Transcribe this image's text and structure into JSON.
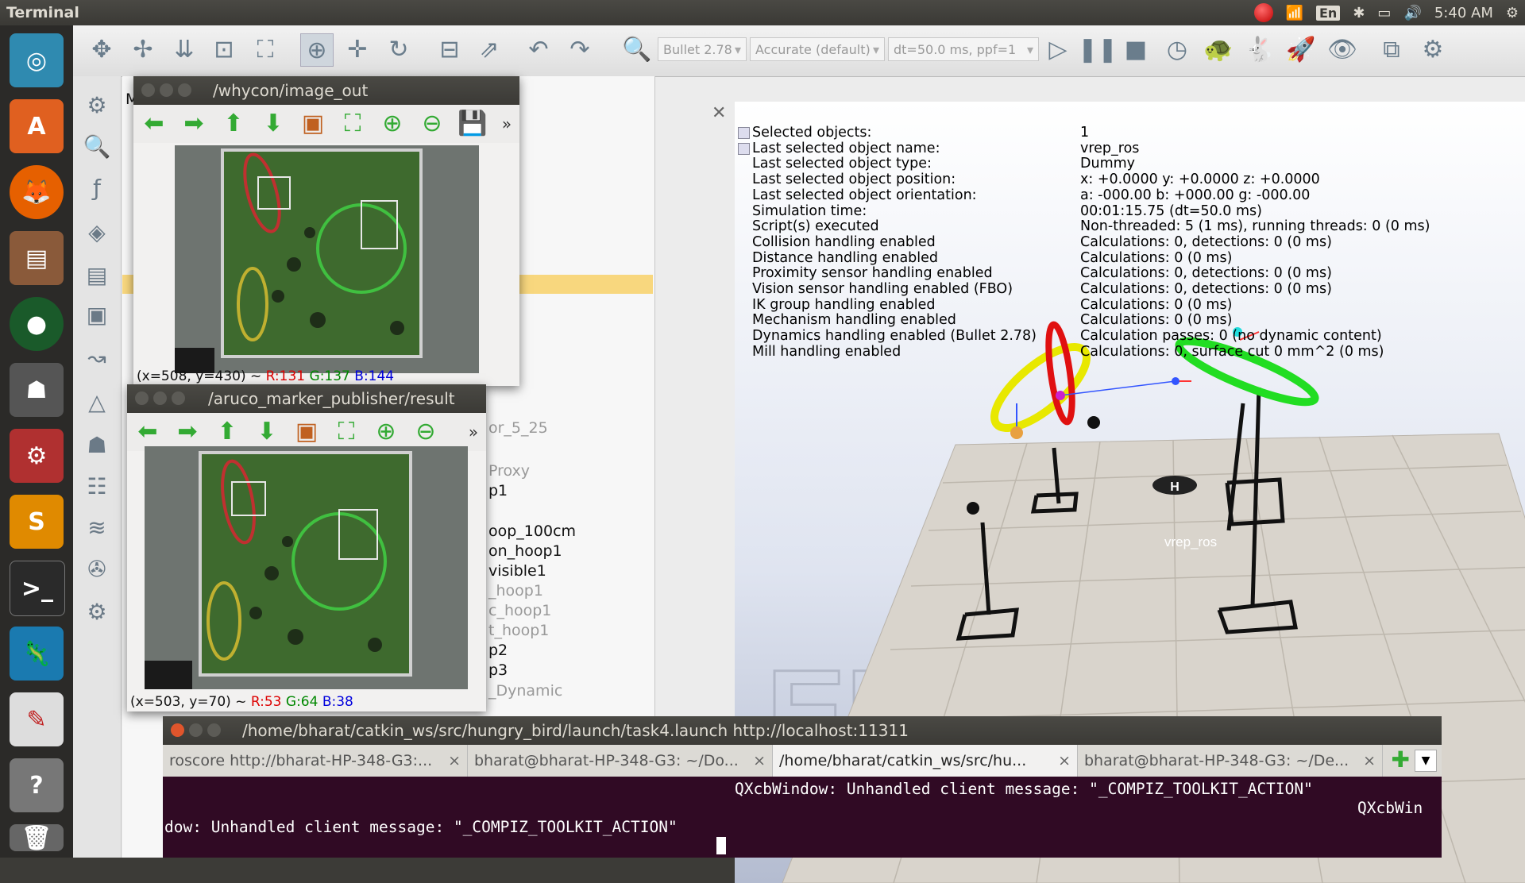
{
  "topbar": {
    "app_title": "Terminal",
    "keyboard_layout": "En",
    "clock": "5:40 AM"
  },
  "launcher": {
    "items": [
      {
        "name": "ubuntu-dash-icon",
        "color": "#2f8ab0"
      },
      {
        "name": "software-center-icon",
        "color": "#e06020"
      },
      {
        "name": "firefox-icon",
        "color": "#e66000"
      },
      {
        "name": "files-icon",
        "color": "#8a5a3a"
      },
      {
        "name": "camera-app-icon",
        "color": "#1a5a2a"
      },
      {
        "name": "robot-app-icon",
        "color": "#555555"
      },
      {
        "name": "system-settings-icon",
        "color": "#b03030"
      },
      {
        "name": "sublime-text-icon",
        "color": "#e08a00"
      },
      {
        "name": "terminal-icon",
        "color": "#2a2a2a"
      },
      {
        "name": "gazebo-icon",
        "color": "#1a7ab0"
      },
      {
        "name": "pdf-viewer-icon",
        "color": "#c02020"
      },
      {
        "name": "help-icon",
        "color": "#777777"
      }
    ]
  },
  "vrep": {
    "physics_engine": "Bullet 2.78",
    "accuracy": "Accurate (default)",
    "timestep": "dt=50.0 ms, ppf=1",
    "hierarchy_items": [
      {
        "text": "M",
        "dim": false
      },
      {
        "text": "or_5_25",
        "dim": true
      },
      {
        "text": "Proxy",
        "dim": true
      },
      {
        "text": "p1",
        "dim": false
      },
      {
        "text": "oop_100cm",
        "dim": false
      },
      {
        "text": "on_hoop1",
        "dim": false
      },
      {
        "text": "visible1",
        "dim": false
      },
      {
        "text": "_hoop1",
        "dim": true
      },
      {
        "text": "c_hoop1",
        "dim": true
      },
      {
        "text": "t_hoop1",
        "dim": true
      },
      {
        "text": "p2",
        "dim": false
      },
      {
        "text": "p3",
        "dim": false
      },
      {
        "text": "_Dynamic",
        "dim": true
      }
    ],
    "info_rows": [
      {
        "k": "Selected objects:",
        "v": "1"
      },
      {
        "k": "Last selected object name:",
        "v": "vrep_ros"
      },
      {
        "k": "Last selected object type:",
        "v": "Dummy"
      },
      {
        "k": "Last selected object position:",
        "v": "x: +0.0000   y: +0.0000   z: +0.0000"
      },
      {
        "k": "Last selected object orientation:",
        "v": "a: -000.00   b: +000.00   g: -000.00"
      },
      {
        "k": "Simulation time:",
        "v": "00:01:15.75 (dt=50.0 ms)"
      },
      {
        "k": "Script(s) executed",
        "v": "Non-threaded: 5 (1 ms), running threads: 0 (0 ms)"
      },
      {
        "k": "Collision handling enabled",
        "v": "Calculations: 0, detections: 0 (0 ms)"
      },
      {
        "k": "Distance handling enabled",
        "v": "Calculations: 0 (0 ms)"
      },
      {
        "k": "Proximity sensor handling enabled",
        "v": "Calculations: 0, detections: 0 (0 ms)"
      },
      {
        "k": "Vision sensor handling enabled (FBO)",
        "v": "Calculations: 0, detections: 0 (0 ms)"
      },
      {
        "k": "IK group handling enabled",
        "v": "Calculations: 0 (0 ms)"
      },
      {
        "k": "Mechanism handling enabled",
        "v": "Calculations: 0 (0 ms)"
      },
      {
        "k": "Dynamics handling enabled (Bullet 2.78)",
        "v": "Calculation passes: 0 (no dynamic content)"
      },
      {
        "k": "Mill handling enabled",
        "v": "Calculations: 0, surface cut 0 mm^2 (0 ms)"
      }
    ],
    "scene_label": "vrep_ros",
    "watermark": "EDU"
  },
  "whycon_window": {
    "title": "/whycon/image_out",
    "status_prefix": "(x=508, y=430) ~ ",
    "r": "R:131",
    "g": "G:137",
    "b": "B:144"
  },
  "aruco_window": {
    "title": "/aruco_marker_publisher/result",
    "status_prefix": "(x=503, y=70) ~ ",
    "r": "R:53",
    "g": "G:64",
    "b": "B:38"
  },
  "terminal": {
    "title": "/home/bharat/catkin_ws/src/hungry_bird/launch/task4.launch http://localhost:11311",
    "tabs": [
      {
        "label": "roscore http://bharat-HP-348-G3:...",
        "active": false
      },
      {
        "label": "bharat@bharat-HP-348-G3: ~/Do...",
        "active": false
      },
      {
        "label": "/home/bharat/catkin_ws/src/hu...",
        "active": true
      },
      {
        "label": "bharat@bharat-HP-348-G3: ~/De...",
        "active": false
      }
    ],
    "line1": "QXcbWindow: Unhandled client message: \"_COMPIZ_TOOLKIT_ACTION\"",
    "line1b": "QXcbWin",
    "line2": "dow: Unhandled client message: \"_COMPIZ_TOOLKIT_ACTION\""
  }
}
